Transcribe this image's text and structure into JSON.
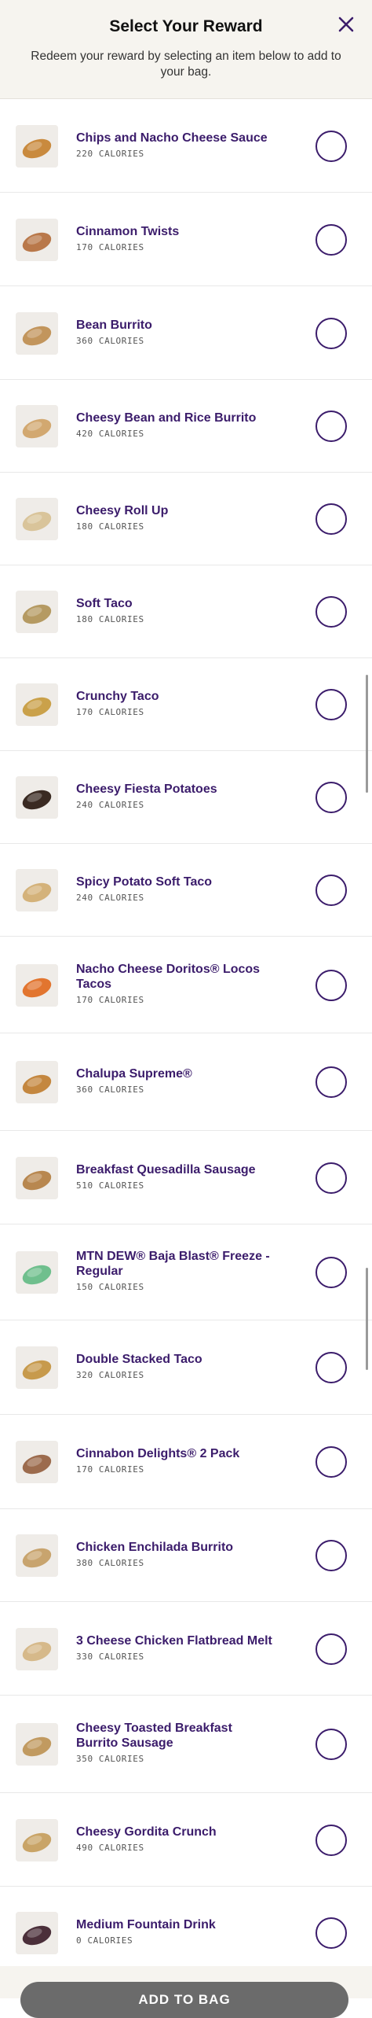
{
  "header": {
    "title": "Select Your Reward",
    "subtitle": "Redeem your reward by selecting an item below to add to your bag.",
    "close_icon": "close-icon"
  },
  "colors": {
    "accent_purple": "#3b1c6b",
    "header_bg": "#f6f4ef",
    "button_disabled": "#6b6b6b"
  },
  "items": [
    {
      "name": "Chips and Nacho Cheese Sauce",
      "calories": "220 CALORIES",
      "icon": "chips-icon",
      "selected": false
    },
    {
      "name": "Cinnamon Twists",
      "calories": "170 CALORIES",
      "icon": "cinnamon-twists-icon",
      "selected": false
    },
    {
      "name": "Bean Burrito",
      "calories": "360 CALORIES",
      "icon": "burrito-icon",
      "selected": false
    },
    {
      "name": "Cheesy Bean and Rice Burrito",
      "calories": "420 CALORIES",
      "icon": "burrito-icon",
      "selected": false
    },
    {
      "name": "Cheesy Roll Up",
      "calories": "180 CALORIES",
      "icon": "roll-up-icon",
      "selected": false
    },
    {
      "name": "Soft Taco",
      "calories": "180 CALORIES",
      "icon": "soft-taco-icon",
      "selected": false
    },
    {
      "name": "Crunchy Taco",
      "calories": "170 CALORIES",
      "icon": "crunchy-taco-icon",
      "selected": false
    },
    {
      "name": "Cheesy Fiesta Potatoes",
      "calories": "240 CALORIES",
      "icon": "potatoes-bowl-icon",
      "selected": false
    },
    {
      "name": "Spicy Potato Soft Taco",
      "calories": "240 CALORIES",
      "icon": "soft-taco-icon",
      "selected": false
    },
    {
      "name": "Nacho Cheese Doritos® Locos Tacos",
      "calories": "170 CALORIES",
      "icon": "doritos-taco-icon",
      "selected": false
    },
    {
      "name": "Chalupa Supreme®",
      "calories": "360 CALORIES",
      "icon": "chalupa-icon",
      "selected": false
    },
    {
      "name": "Breakfast Quesadilla Sausage",
      "calories": "510 CALORIES",
      "icon": "quesadilla-icon",
      "selected": false
    },
    {
      "name": "MTN DEW® Baja Blast® Freeze - Regular",
      "calories": "150 CALORIES",
      "icon": "freeze-cup-icon",
      "selected": false
    },
    {
      "name": "Double Stacked Taco",
      "calories": "320 CALORIES",
      "icon": "taco-icon",
      "selected": false
    },
    {
      "name": "Cinnabon Delights® 2 Pack",
      "calories": "170 CALORIES",
      "icon": "cinnabon-delights-icon",
      "selected": false
    },
    {
      "name": "Chicken Enchilada Burrito",
      "calories": "380 CALORIES",
      "icon": "burrito-icon",
      "selected": false
    },
    {
      "name": "3 Cheese Chicken Flatbread Melt",
      "calories": "330 CALORIES",
      "icon": "flatbread-icon",
      "selected": false
    },
    {
      "name": "Cheesy Toasted Breakfast Burrito Sausage",
      "calories": "350 CALORIES",
      "icon": "breakfast-burrito-icon",
      "selected": false
    },
    {
      "name": "Cheesy Gordita Crunch",
      "calories": "490 CALORIES",
      "icon": "gordita-icon",
      "selected": false
    },
    {
      "name": "Medium Fountain Drink",
      "calories": "0 CALORIES",
      "icon": "fountain-drink-icon",
      "selected": false
    }
  ],
  "footer": {
    "add_button_label": "ADD TO BAG"
  }
}
